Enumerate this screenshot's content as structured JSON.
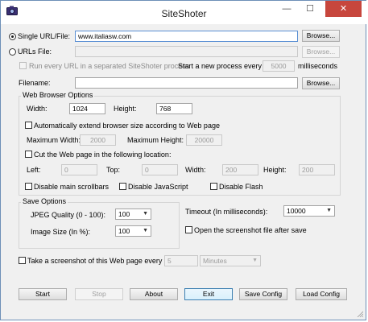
{
  "window": {
    "title": "SiteShoter",
    "minimize": "—",
    "maximize": "☐",
    "close": "✕"
  },
  "source": {
    "single_label": "Single URL/File:",
    "single_value": "www.italiasw.com",
    "single_browse": "Browse...",
    "urls_label": "URLs File:",
    "urls_value": "",
    "urls_browse": "Browse...",
    "separate_label": "Run every URL in a separated SiteShoter process",
    "new_process_label": "Start a new process every",
    "new_process_value": "5000",
    "ms_label": "milliseconds"
  },
  "filename": {
    "label": "Filename:",
    "value": "",
    "browse": "Browse..."
  },
  "browser": {
    "title": "Web Browser Options",
    "width_label": "Width:",
    "width_value": "1024",
    "height_label": "Height:",
    "height_value": "768",
    "auto_extend_label": "Automatically extend browser size according to Web page",
    "max_width_label": "Maximum Width:",
    "max_width_value": "2000",
    "max_height_label": "Maximum Height:",
    "max_height_value": "20000",
    "cut_label": "Cut the Web page in the following location:",
    "left_label": "Left:",
    "left_value": "0",
    "top_label": "Top:",
    "top_value": "0",
    "cut_width_label": "Width:",
    "cut_width_value": "200",
    "cut_height_label": "Height:",
    "cut_height_value": "200",
    "disable_scroll_label": "Disable main scrollbars",
    "disable_js_label": "Disable JavaScript",
    "disable_flash_label": "Disable Flash"
  },
  "save": {
    "title": "Save Options",
    "jpeg_label": "JPEG Quality (0 - 100):",
    "jpeg_value": "100",
    "size_label": "Image Size (In %):",
    "size_value": "100",
    "timeout_label": "Timeout (In milliseconds):",
    "timeout_value": "10000",
    "open_after_label": "Open the screenshot file after save"
  },
  "periodic": {
    "label": "Take a screenshot of this Web page every",
    "value": "5",
    "unit": "Minutes"
  },
  "buttons": {
    "start": "Start",
    "stop": "Stop",
    "about": "About",
    "exit": "Exit",
    "save_config": "Save Config",
    "load_config": "Load Config"
  }
}
